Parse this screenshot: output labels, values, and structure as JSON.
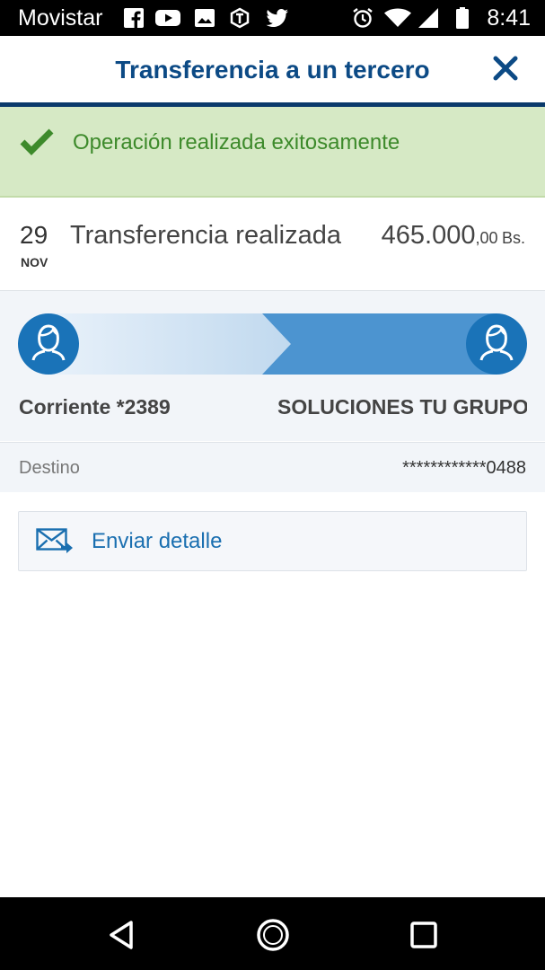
{
  "status_bar": {
    "carrier": "Movistar",
    "time": "8:41",
    "icons": [
      "facebook-icon",
      "youtube-icon",
      "gallery-icon",
      "app-icon",
      "twitter-icon",
      "alarm-icon",
      "wifi-icon",
      "signal-icon",
      "battery-icon"
    ]
  },
  "header": {
    "title": "Transferencia a un tercero",
    "close_icon": "close-icon"
  },
  "banner": {
    "message": "Operación realizada exitosamente",
    "icon": "check-icon"
  },
  "transaction": {
    "day": "29",
    "month": "NOV",
    "description": "Transferencia realizada",
    "amount_integer": "465.000",
    "amount_decimal": ",00",
    "currency": "Bs."
  },
  "flow": {
    "from_account": "Corriente *2389",
    "to_name": "SOLUCIONES TU GRUPO"
  },
  "destination": {
    "label": "Destino",
    "value": "************0488"
  },
  "actions": {
    "send_detail_label": "Enviar detalle",
    "send_icon": "mail-send-icon"
  },
  "nav": {
    "items": [
      "back-icon",
      "home-icon",
      "recents-icon"
    ]
  },
  "colors": {
    "brand": "#0c4a85",
    "success_bg": "#d6e9c5",
    "success_text": "#3d8a2b",
    "accent": "#1a73b8"
  }
}
